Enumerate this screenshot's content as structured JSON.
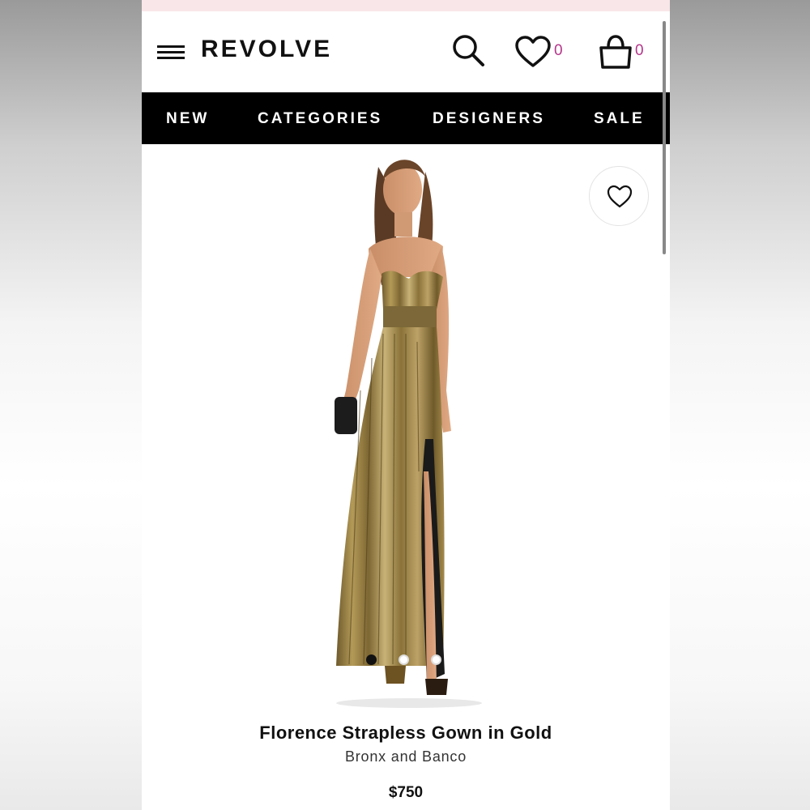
{
  "header": {
    "logo": "REVOLVE",
    "wishlist_count": "0",
    "bag_count": "0",
    "icons": [
      "menu-icon",
      "search-icon",
      "heart-icon",
      "shopping-bag-icon"
    ]
  },
  "nav": {
    "items": [
      {
        "label": "NEW"
      },
      {
        "label": "CATEGORIES"
      },
      {
        "label": "DESIGNERS"
      },
      {
        "label": "SALE"
      }
    ]
  },
  "product": {
    "title": "Florence Strapless Gown in Gold",
    "brand": "Bronx and Banco",
    "price": "$750",
    "image_count": 3,
    "active_image": 1
  },
  "colors": {
    "accent": "#b5368b",
    "nav_background": "#000000",
    "promo_strip": "#f9e6e8",
    "dress_gold": "#9c8548"
  }
}
